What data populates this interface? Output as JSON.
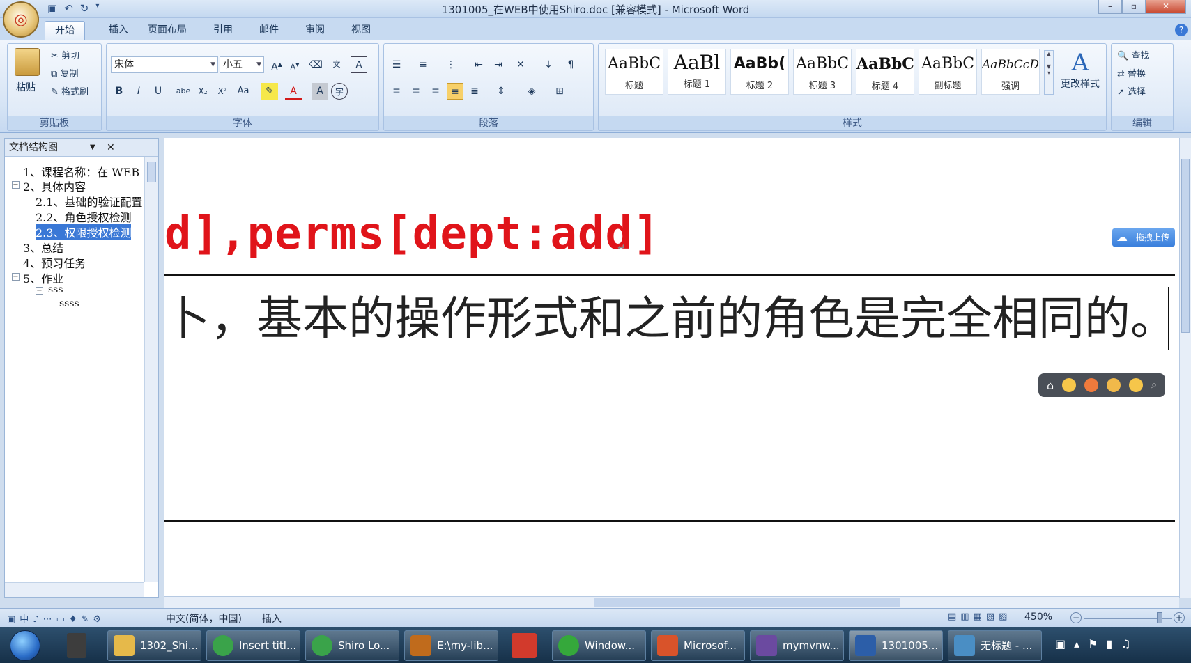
{
  "window": {
    "title": "1301005_在WEB中使用Shiro.doc [兼容模式] - Microsoft Word",
    "office_button_icon": "office-logo-icon",
    "qat": [
      "save-icon",
      "undo-icon",
      "redo-icon",
      "customize-icon"
    ]
  },
  "tabs": [
    "开始",
    "插入",
    "页面布局",
    "引用",
    "邮件",
    "审阅",
    "视图"
  ],
  "ribbon": {
    "clipboard": {
      "label": "剪贴板",
      "paste": "粘贴",
      "cut": "剪切",
      "copy": "复制",
      "format_painter": "格式刷"
    },
    "font": {
      "label": "字体",
      "font_name": "宋体",
      "font_size": "小五",
      "buttons": [
        "B",
        "I",
        "U",
        "abe",
        "X₂",
        "X²",
        "Aa",
        "A",
        "A"
      ]
    },
    "paragraph": {
      "label": "段落"
    },
    "styles": {
      "label": "样式",
      "tiles": [
        {
          "preview": "AaBbC",
          "name": "标题"
        },
        {
          "preview": "AaBl",
          "name": "标题 1"
        },
        {
          "preview": "AaBb(",
          "name": "标题 2"
        },
        {
          "preview": "AaBbC",
          "name": "标题 3"
        },
        {
          "preview": "AaBbC",
          "name": "标题 4"
        },
        {
          "preview": "AaBbC",
          "name": "副标题"
        },
        {
          "preview": "AaBbCcD",
          "name": "强调"
        }
      ],
      "change_styles": "更改样式"
    },
    "editing": {
      "label": "编辑",
      "find": "查找",
      "replace": "替换",
      "select": "选择"
    }
  },
  "nav": {
    "title": "文档结构图",
    "items": [
      {
        "text": "1、课程名称：在 WEB",
        "level": 1
      },
      {
        "text": "2、具体内容",
        "level": 1
      },
      {
        "text": "2.1、基础的验证配置",
        "level": 2
      },
      {
        "text": "2.2、角色授权检测",
        "level": 2
      },
      {
        "text": "2.3、权限授权检测",
        "level": 2
      },
      {
        "text": "3、总结",
        "level": 1
      },
      {
        "text": "4、预习任务",
        "level": 1
      },
      {
        "text": "5、作业",
        "level": 1
      },
      {
        "text": "sss",
        "level": 2
      },
      {
        "text": "ssss",
        "level": 3
      }
    ]
  },
  "document": {
    "code_line": "d],perms[dept:add]",
    "text_line": "卜，基本的操作形式和之前的角色是完全相同的。",
    "upload_button": "拖拽上传"
  },
  "status": {
    "language": "中文(简体，中国)",
    "mode": "插入",
    "zoom": "450%"
  },
  "taskbar": {
    "items": [
      {
        "label": "1302_Shi...",
        "color": "#e6b94a"
      },
      {
        "label": "Insert titl...",
        "color": "#3aa34a"
      },
      {
        "label": "Shiro Lo...",
        "color": "#3aa34a"
      },
      {
        "label": "E:\\my-lib...",
        "color": "#c06b1c"
      },
      {
        "label": "Window...",
        "color": "#35a83b"
      },
      {
        "label": "Microsof...",
        "color": "#d9532a"
      },
      {
        "label": "mymvnw...",
        "color": "#6b4aa0"
      },
      {
        "label": "1301005...",
        "color": "#2c5ea8"
      },
      {
        "label": "无标题 - ...",
        "color": "#4a8ec4"
      }
    ]
  }
}
